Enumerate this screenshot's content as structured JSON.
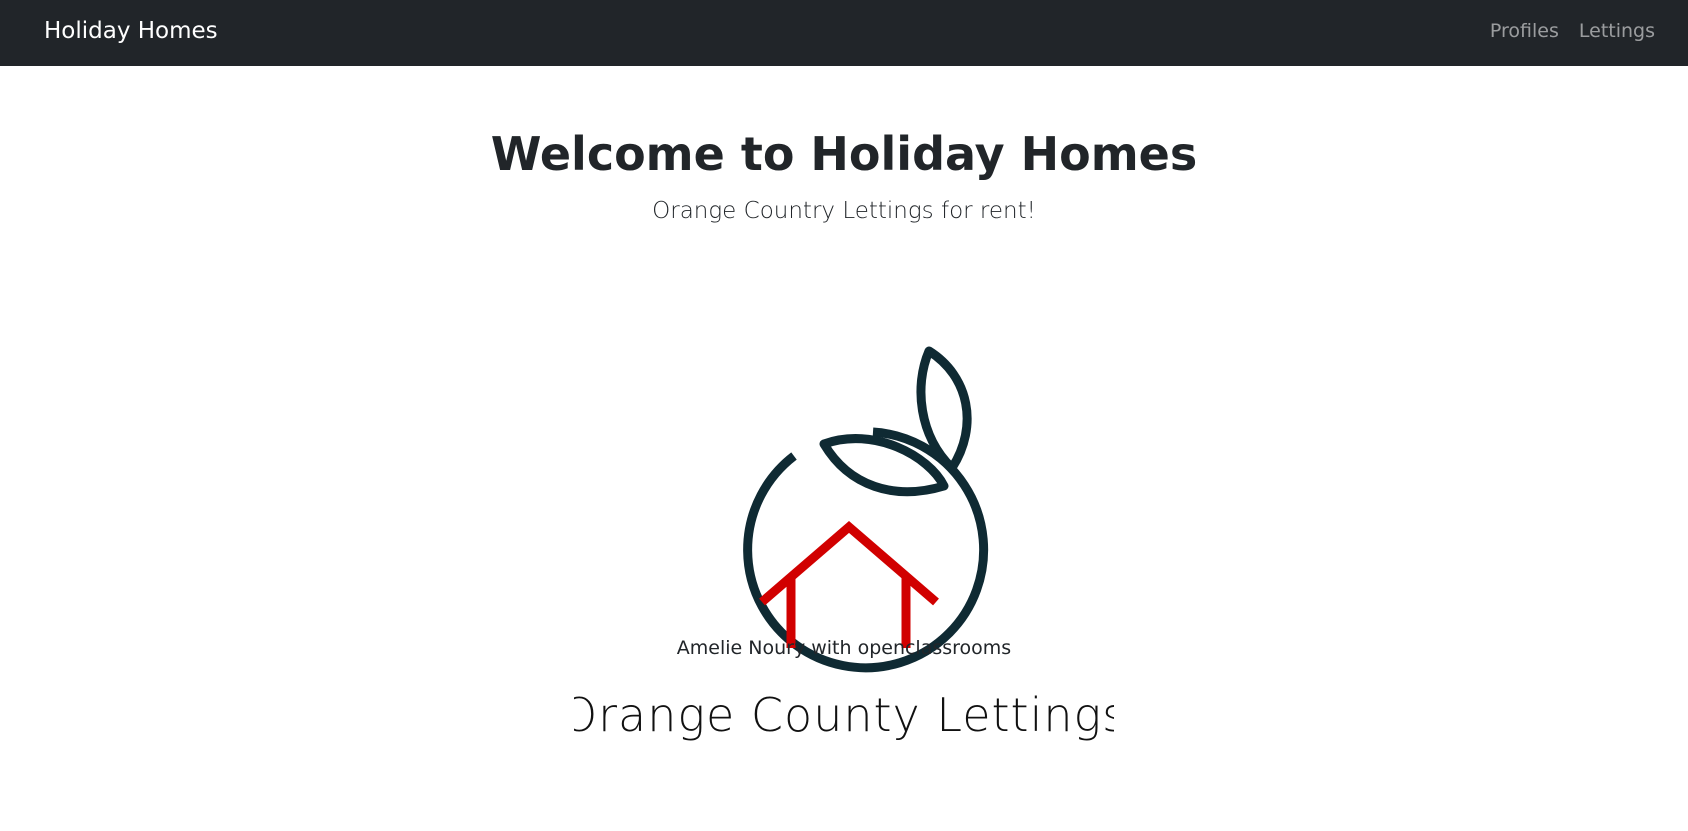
{
  "navbar": {
    "brand": "Holiday Homes",
    "links": [
      {
        "label": "Profiles"
      },
      {
        "label": "Lettings"
      }
    ]
  },
  "hero": {
    "title": "Welcome to Holiday Homes",
    "subtitle": "Orange Country Lettings for rent!"
  },
  "logo": {
    "wordmark": "Orange County Lettings",
    "colors": {
      "outline": "#0f2a33",
      "house": "#d10000"
    }
  },
  "credit": "Amelie Noury with openclassrooms",
  "colors": {
    "navbar_bg": "#212529",
    "brand_text": "#ffffff",
    "nav_link_text": "#9a9da0",
    "body_text": "#212529"
  }
}
